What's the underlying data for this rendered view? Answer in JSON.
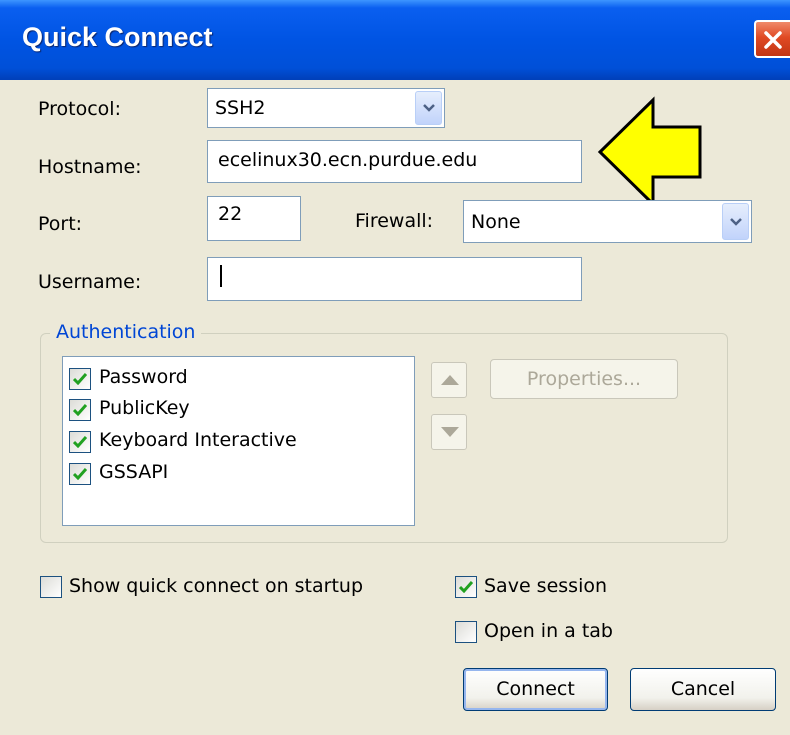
{
  "window": {
    "title": "Quick Connect"
  },
  "form": {
    "protocol_label": "Protocol:",
    "protocol_value": "SSH2",
    "hostname_label": "Hostname:",
    "hostname_value": "ecelinux30.ecn.purdue.edu",
    "port_label": "Port:",
    "port_value": "22",
    "firewall_label": "Firewall:",
    "firewall_value": "None",
    "username_label": "Username:",
    "username_value": ""
  },
  "authentication": {
    "legend": "Authentication",
    "methods": [
      {
        "label": "Password",
        "checked": true
      },
      {
        "label": "PublicKey",
        "checked": true
      },
      {
        "label": "Keyboard Interactive",
        "checked": true
      },
      {
        "label": "GSSAPI",
        "checked": true
      }
    ],
    "properties_label": "Properties..."
  },
  "options": {
    "show_on_startup_label": "Show quick connect on startup",
    "show_on_startup_checked": false,
    "save_session_label": "Save session",
    "save_session_checked": true,
    "open_in_tab_label": "Open in a tab",
    "open_in_tab_checked": false
  },
  "buttons": {
    "connect_label": "Connect",
    "cancel_label": "Cancel"
  },
  "annotation": {
    "arrow_color": "#ffff00",
    "arrow_icon": "left-arrow-icon"
  }
}
